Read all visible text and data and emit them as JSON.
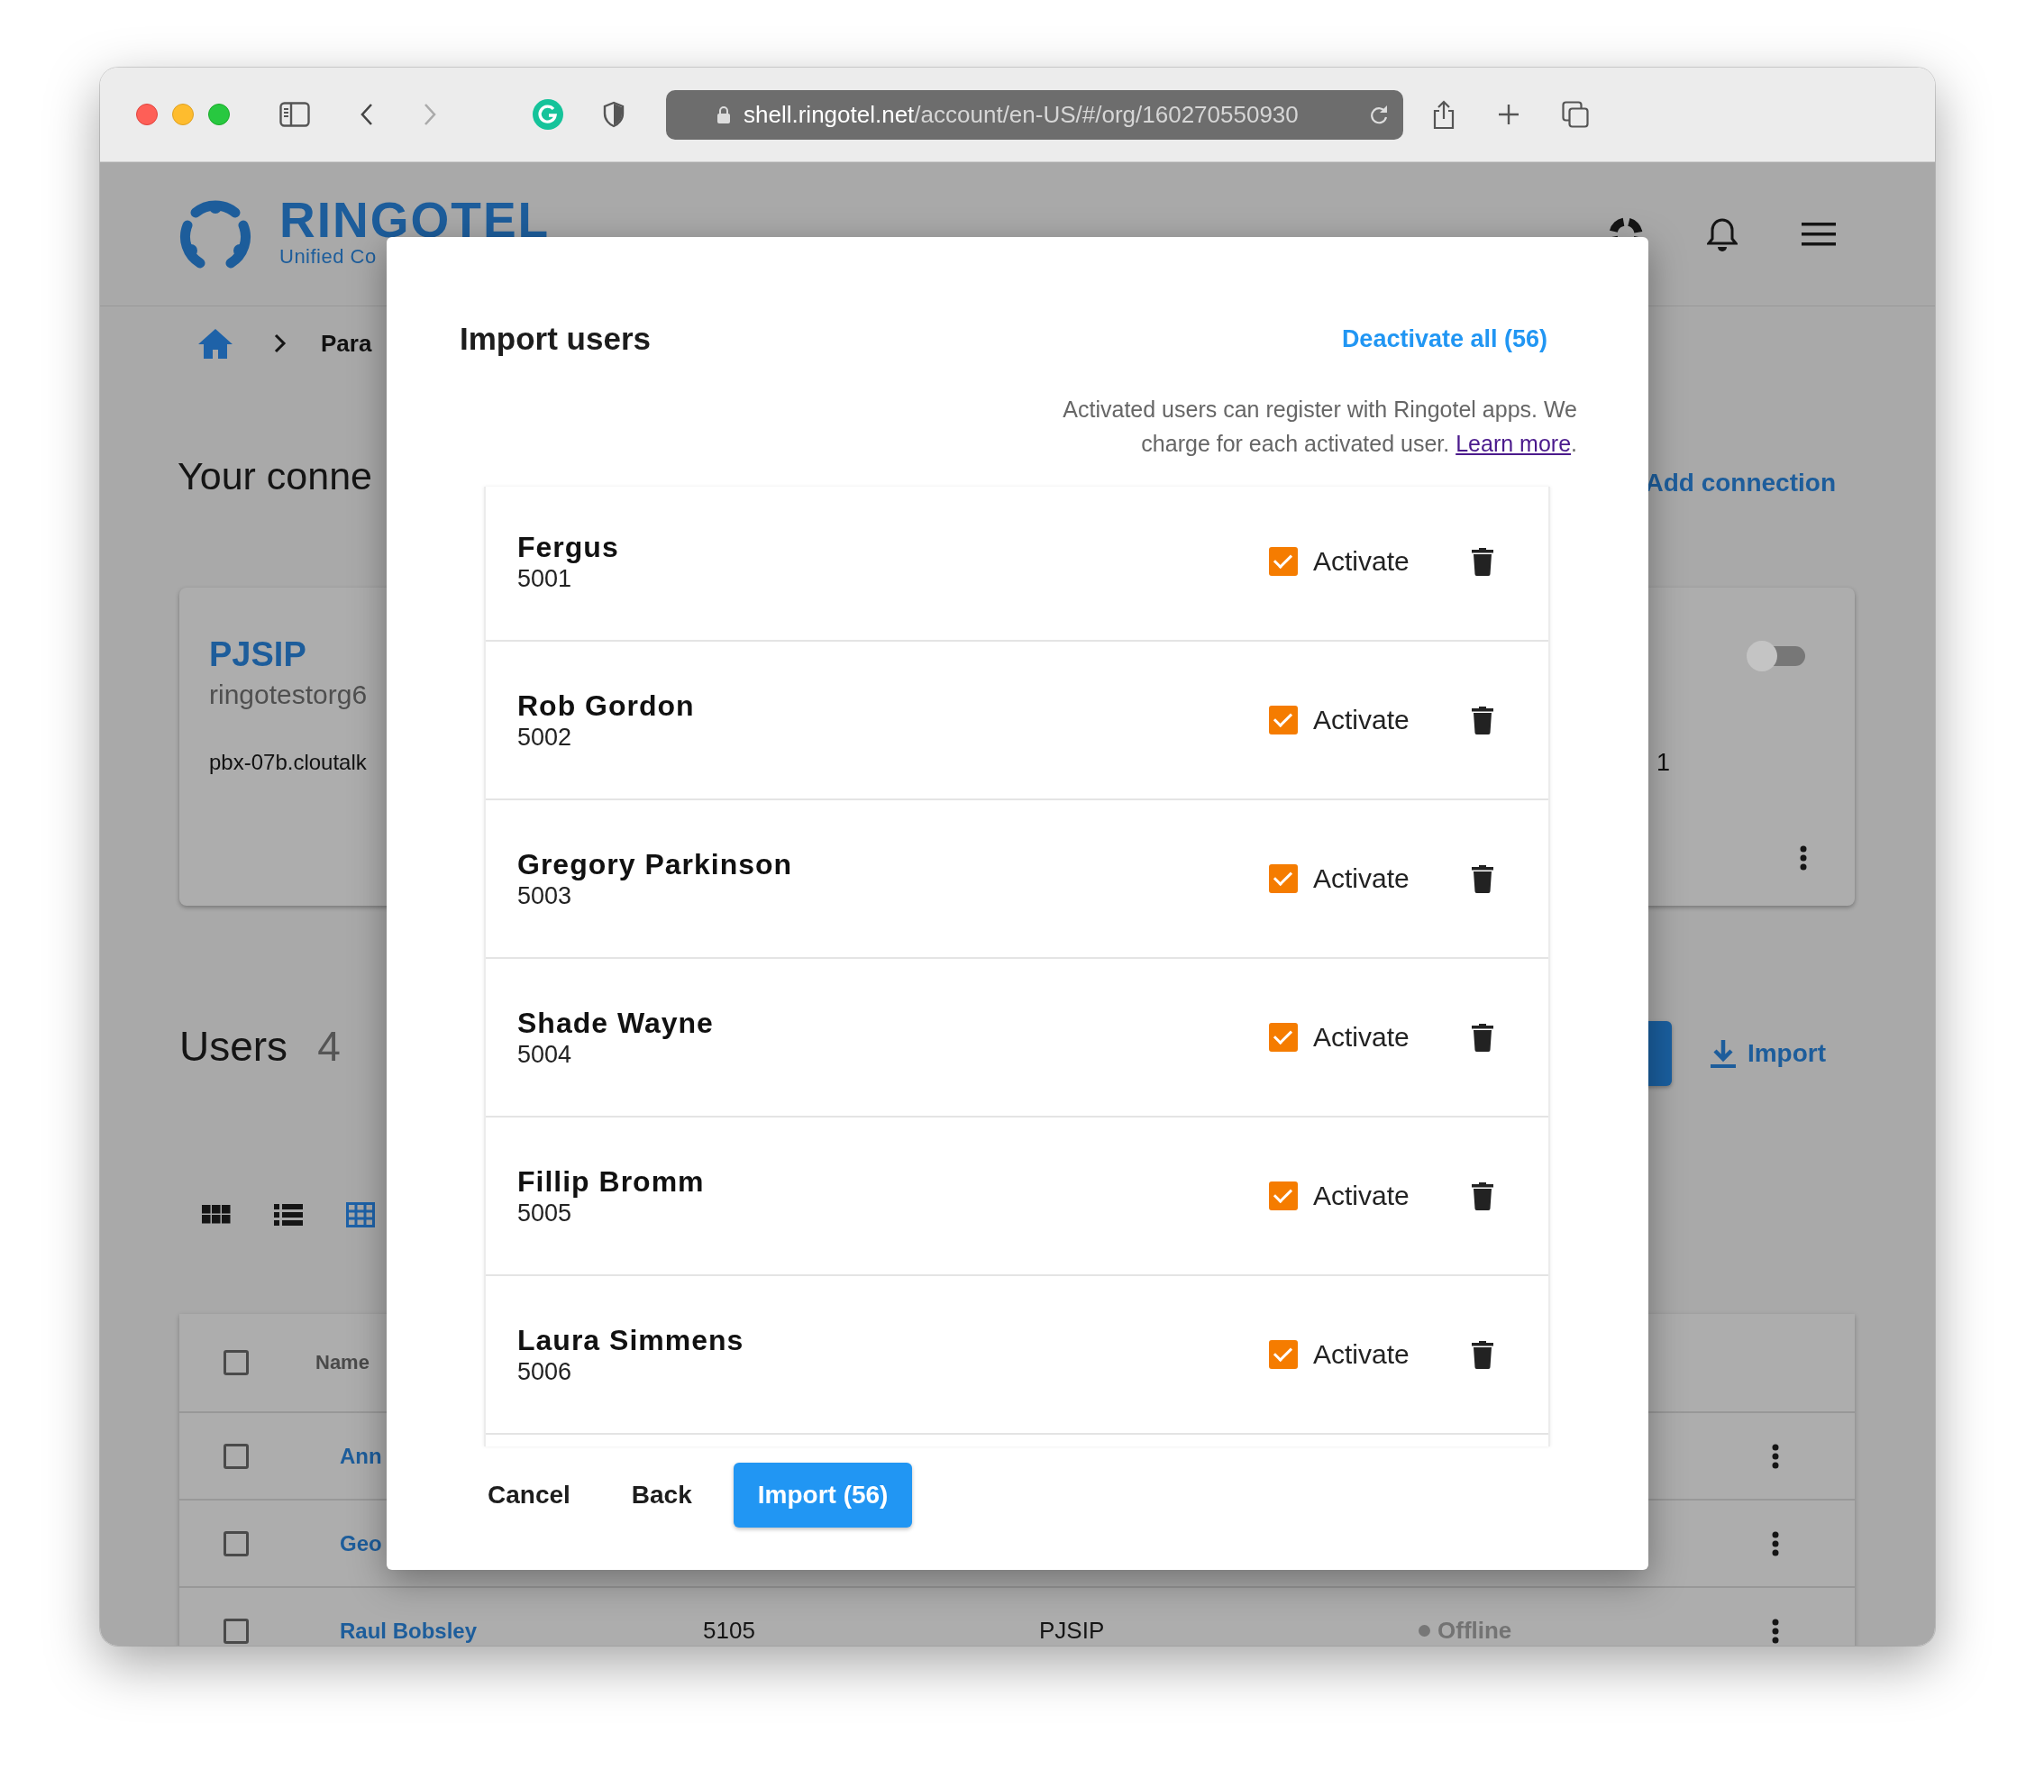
{
  "browser": {
    "url_host": "shell.ringotel.net",
    "url_path": "/account/en-US/#/org/160270550930"
  },
  "header": {
    "logo_title": "RINGOTEL",
    "logo_subtitle": "Unified Co"
  },
  "breadcrumb": {
    "current": "Para"
  },
  "connections": {
    "title": "Your conne",
    "add_link": "Add connection",
    "card": {
      "name": "PJSIP",
      "org": "ringotestorg6",
      "host": "pbx-07b.cloutalk",
      "column_2": "1",
      "enabled": false
    }
  },
  "users": {
    "title": "Users",
    "count": "4",
    "import_link": "Import",
    "views": [
      {
        "kind": "tiles",
        "selected": false
      },
      {
        "kind": "list",
        "selected": false
      },
      {
        "kind": "grid",
        "selected": true
      }
    ],
    "table": {
      "header_checked": false,
      "columns": [
        "Name"
      ],
      "rows": [
        {
          "name": "Ann",
          "checked": false
        },
        {
          "name": "Geo",
          "checked": false
        },
        {
          "name": "Raul Bobsley",
          "extension": "5105",
          "connection": "PJSIP",
          "status": "Offline",
          "checked": false
        }
      ]
    }
  },
  "dialog": {
    "title": "Import users",
    "deactivate_all": "Deactivate all (56)",
    "note": "Activated users can register with Ringotel apps. We charge for each activated user.",
    "learn_more": "Learn more",
    "note_end": ".",
    "users": [
      {
        "name": "Fergus",
        "extension": "5001",
        "activate_label": "Activate",
        "activated": true
      },
      {
        "name": "Rob Gordon",
        "extension": "5002",
        "activate_label": "Activate",
        "activated": true
      },
      {
        "name": "Gregory Parkinson",
        "extension": "5003",
        "activate_label": "Activate",
        "activated": true
      },
      {
        "name": "Shade Wayne",
        "extension": "5004",
        "activate_label": "Activate",
        "activated": true
      },
      {
        "name": "Fillip Bromm",
        "extension": "5005",
        "activate_label": "Activate",
        "activated": true
      },
      {
        "name": "Laura Simmens",
        "extension": "5006",
        "activate_label": "Activate",
        "activated": true
      }
    ],
    "buttons": {
      "cancel": "Cancel",
      "back": "Back",
      "import": "Import (56)"
    }
  }
}
